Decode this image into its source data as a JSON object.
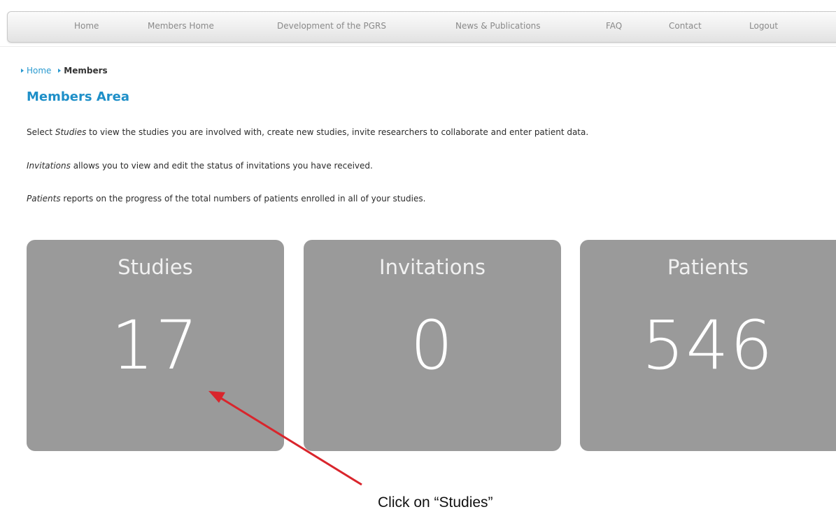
{
  "nav": {
    "items": [
      {
        "label": "Home"
      },
      {
        "label": "Members Home"
      },
      {
        "label": "Development of the PGRS"
      },
      {
        "label": "News & Publications"
      },
      {
        "label": "FAQ"
      },
      {
        "label": "Contact"
      },
      {
        "label": "Logout"
      }
    ]
  },
  "breadcrumb": {
    "home": "Home",
    "current": "Members"
  },
  "page": {
    "title": "Members Area",
    "paragraphs": [
      {
        "em": "Studies",
        "prefix": "Select ",
        "text": " to view the studies you are involved with, create new studies, invite researchers to collaborate and enter patient data."
      },
      {
        "em": "Invitations",
        "prefix": "",
        "text": " allows you to view and edit the status of invitations you have received."
      },
      {
        "em": "Patients",
        "prefix": "",
        "text": " reports on the progress of the total numbers of patients enrolled in all of your studies."
      }
    ]
  },
  "tiles": [
    {
      "label": "Studies",
      "value": "17"
    },
    {
      "label": "Invitations",
      "value": "0"
    },
    {
      "label": "Patients",
      "value": "546"
    }
  ],
  "annotation": {
    "text": "Click on “Studies”",
    "arrow_color": "#d9252c"
  },
  "colors": {
    "accent": "#1e8fc8",
    "tile_bg": "#9a9a9a"
  }
}
